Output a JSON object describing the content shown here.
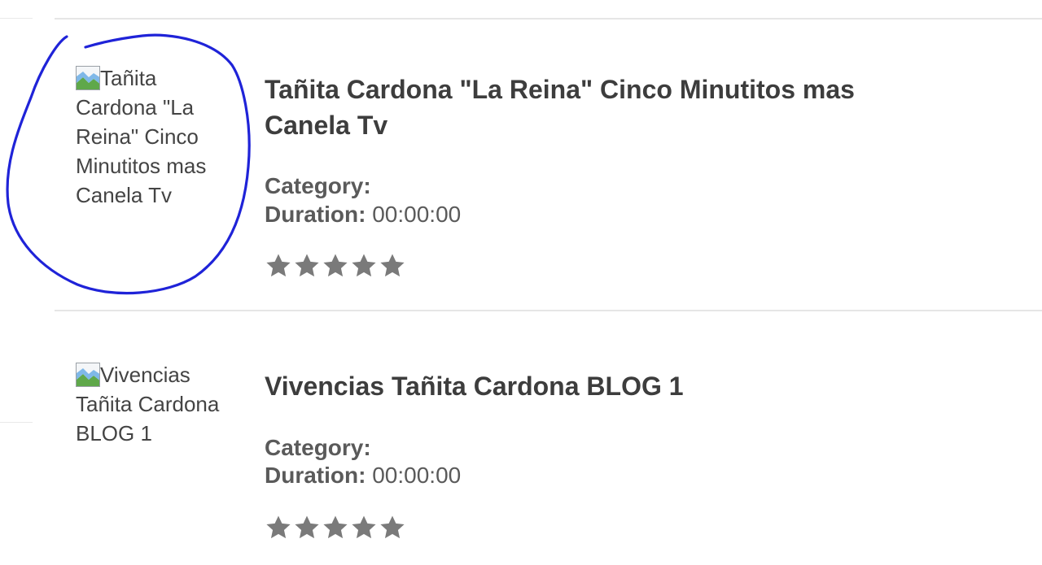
{
  "videos": [
    {
      "thumbnail_alt": "Tañita Cardona \"La Reina\" Cinco Minutitos mas Canela Tv",
      "title": "Tañita Cardona \"La Reina\" Cinco Minutitos mas Canela Tv",
      "category_label": "Category:",
      "category_value": "",
      "duration_label": "Duration:",
      "duration_value": "00:00:00",
      "rating_stars": 5,
      "rating_value": 0
    },
    {
      "thumbnail_alt": "Vivencias Tañita Cardona BLOG 1",
      "title": "Vivencias Tañita Cardona BLOG 1",
      "category_label": "Category:",
      "category_value": "",
      "duration_label": "Duration:",
      "duration_value": "00:00:00",
      "rating_stars": 5,
      "rating_value": 0
    }
  ],
  "colors": {
    "title": "#3d3d3d",
    "meta": "#5a5a5a",
    "star": "#7a7a7a",
    "annotation": "#1f23d8",
    "divider": "#e6e6e6"
  },
  "icons": {
    "thumbnail": "broken-image-icon",
    "rating": "star-icon"
  }
}
